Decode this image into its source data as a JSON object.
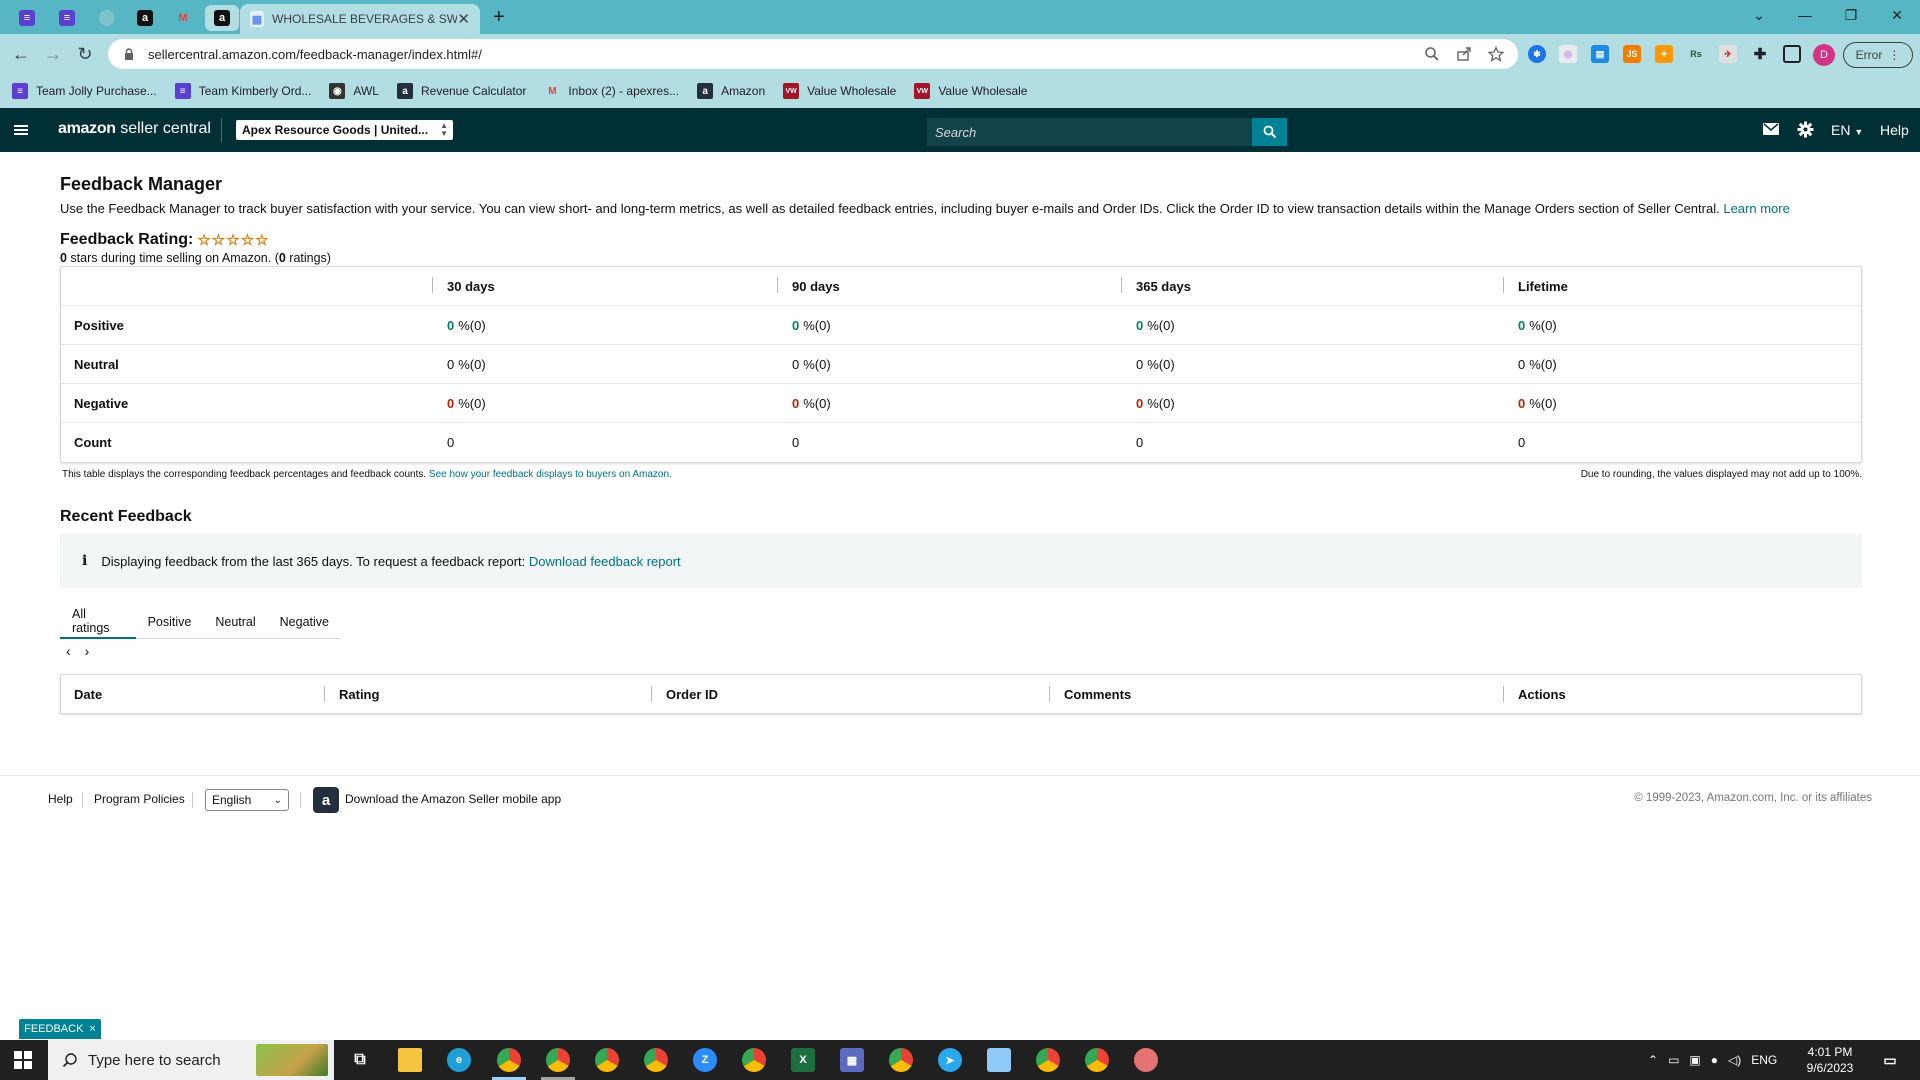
{
  "browser": {
    "active_tab_title": "WHOLESALE BEVERAGES & SWEETS...",
    "url": "sellercentral.amazon.com/feedback-manager/index.html#/",
    "profile_initial": "D",
    "error_label": "Error",
    "bookmarks": [
      {
        "label": "Team Jolly Purchase...",
        "icon": "list-icon",
        "color": "#5b3fd1"
      },
      {
        "label": "Team Kimberly Ord...",
        "icon": "list-icon",
        "color": "#5b3fd1"
      },
      {
        "label": "AWL",
        "icon": "globe-icon",
        "color": "#333333"
      },
      {
        "label": "Revenue Calculator",
        "icon": "amazon-icon",
        "color": "#232f3e"
      },
      {
        "label": "Inbox (2) - apexres...",
        "icon": "gmail-icon",
        "color": "#ea4335"
      },
      {
        "label": "Amazon",
        "icon": "amazon-icon",
        "color": "#232f3e"
      },
      {
        "label": "Value Wholesale",
        "icon": "vw-icon",
        "color": "#a3162a"
      },
      {
        "label": "Value Wholesale",
        "icon": "vw-icon",
        "color": "#a3162a"
      }
    ]
  },
  "header": {
    "logo_bold": "amazon",
    "logo_rest": " seller central",
    "account": "Apex Resource Goods | United...",
    "search_placeholder": "Search",
    "language": "EN",
    "help": "Help"
  },
  "page": {
    "title": "Feedback Manager",
    "intro": "Use the Feedback Manager to track buyer satisfaction with your service. You can view short- and long-term metrics, as well as detailed feedback entries, including buyer e-mails and Order IDs. Click the Order ID to view transaction details within the Manage Orders section of Seller Central.",
    "learn_more": "Learn more",
    "rating_label": "Feedback Rating:",
    "stars_text": "☆☆☆☆☆",
    "stars_count": "0",
    "stars_suffix": " stars during time selling on Amazon. (",
    "ratings_count": "0",
    "ratings_suffix": " ratings)"
  },
  "feedback_table": {
    "columns": [
      "30 days",
      "90 days",
      "365 days",
      "Lifetime"
    ],
    "rows": [
      {
        "label": "Positive",
        "values": [
          "0",
          "0",
          "0",
          "0"
        ],
        "suffix": "%(0)"
      },
      {
        "label": "Neutral",
        "values": [
          "0",
          "0",
          "0",
          "0"
        ],
        "suffix": "%(0)"
      },
      {
        "label": "Negative",
        "values": [
          "0",
          "0",
          "0",
          "0"
        ],
        "suffix": "%(0)"
      },
      {
        "label": "Count",
        "values": [
          "0",
          "0",
          "0",
          "0"
        ]
      }
    ],
    "note": "This table displays the corresponding feedback percentages and feedback counts.",
    "note_link": "See how your feedback displays to buyers on Amazon.",
    "rounding_note": "Due to rounding, the values displayed may not add up to 100%."
  },
  "recent": {
    "title": "Recent Feedback",
    "info": "Displaying feedback from the last 365 days. To request a feedback report:",
    "info_link": "Download feedback report",
    "tabs": [
      "All ratings",
      "Positive",
      "Neutral",
      "Negative"
    ],
    "active_tab": "All ratings",
    "columns": [
      "Date",
      "Rating",
      "Order ID",
      "Comments",
      "Actions"
    ]
  },
  "footer": {
    "help": "Help",
    "policies": "Program Policies",
    "language": "English",
    "app_text": "Download the Amazon Seller mobile app",
    "copyright": "© 1999-2023, Amazon.com, Inc. or its affiliates"
  },
  "feedback_pill": "FEEDBACK",
  "taskbar": {
    "search_placeholder": "Type here to search",
    "language": "ENG",
    "time": "4:01 PM",
    "date": "9/6/2023"
  }
}
